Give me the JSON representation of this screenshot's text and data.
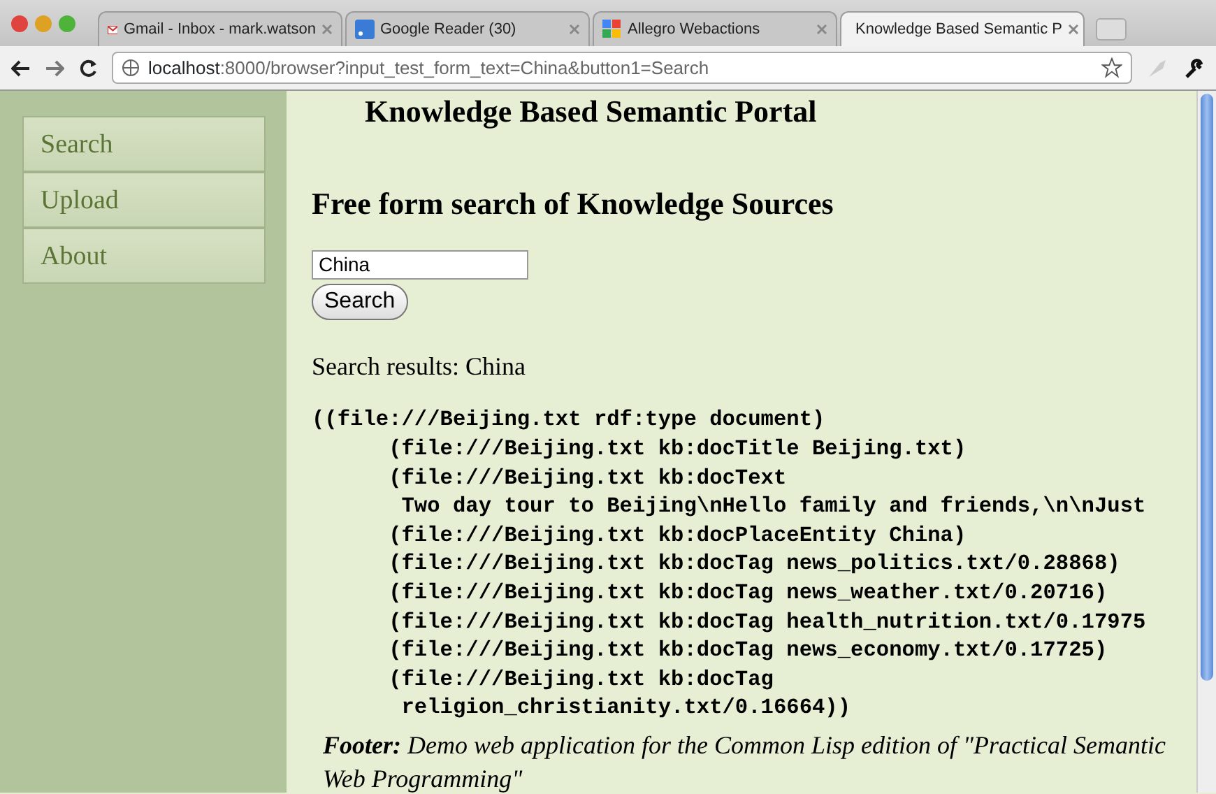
{
  "browser": {
    "tabs": [
      {
        "title": "Gmail - Inbox - mark.watson",
        "selected": false,
        "kind": "mail"
      },
      {
        "title": "Google Reader (30)",
        "selected": false,
        "kind": "feed"
      },
      {
        "title": "Allegro Webactions",
        "selected": false,
        "kind": "app"
      },
      {
        "title": "Knowledge Based Semantic P",
        "selected": true,
        "kind": "page"
      }
    ],
    "address": {
      "host": "localhost",
      "rest": ":8000/browser?input_test_form_text=China&button1=Search"
    }
  },
  "sidebar": {
    "items": [
      {
        "label": "Search"
      },
      {
        "label": "Upload"
      },
      {
        "label": "About"
      }
    ]
  },
  "page": {
    "title": "Knowledge Based Semantic Portal",
    "heading": "Free form search of Knowledge Sources",
    "search": {
      "value": "China",
      "button": "Search"
    },
    "results_label": "Search results: China",
    "results": [
      "((file:///Beijing.txt rdf:type document)",
      "      (file:///Beijing.txt kb:docTitle Beijing.txt)",
      "      (file:///Beijing.txt kb:docText",
      "       Two day tour to Beijing\\nHello family and friends,\\n\\nJust",
      "      (file:///Beijing.txt kb:docPlaceEntity China)",
      "      (file:///Beijing.txt kb:docTag news_politics.txt/0.28868)",
      "      (file:///Beijing.txt kb:docTag news_weather.txt/0.20716)",
      "      (file:///Beijing.txt kb:docTag health_nutrition.txt/0.17975",
      "      (file:///Beijing.txt kb:docTag news_economy.txt/0.17725)",
      "      (file:///Beijing.txt kb:docTag",
      "       religion_christianity.txt/0.16664))"
    ],
    "footer": "**Footer:** Demo web application for the Common Lisp edition of \"Practical Semantic Web Programming\""
  }
}
